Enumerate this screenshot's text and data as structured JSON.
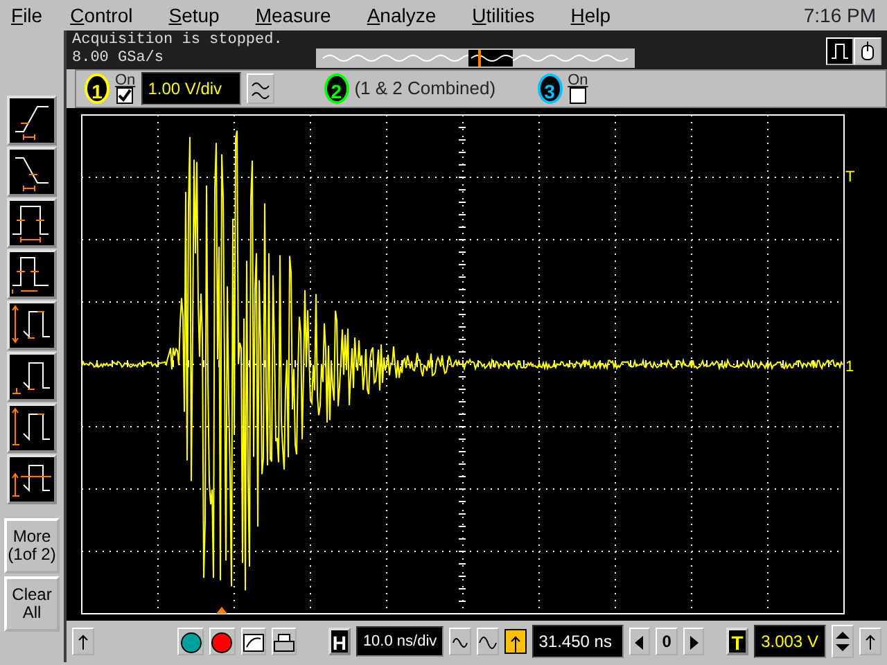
{
  "menu": [
    {
      "label": "File"
    },
    {
      "label": "Control"
    },
    {
      "label": "Setup"
    },
    {
      "label": "Measure"
    },
    {
      "label": "Analyze"
    },
    {
      "label": "Utilities"
    },
    {
      "label": "Help"
    }
  ],
  "clock": "7:16 PM",
  "status": {
    "message": "Acquisition is stopped.",
    "sample_rate": "8.00 GSa/s"
  },
  "channels": [
    {
      "kind": "scaled",
      "number": "1",
      "color": "#ffff00",
      "on_label": "On",
      "checked": true,
      "scale": "1.00 V/div"
    },
    {
      "kind": "combined",
      "number": "2",
      "color": "#00ff00",
      "label": "(1 & 2 Combined)"
    },
    {
      "kind": "toggle",
      "number": "3",
      "color": "#00c0ff",
      "on_label": "On",
      "checked": false
    }
  ],
  "tools": [
    {
      "kind": "rise"
    },
    {
      "kind": "fall"
    },
    {
      "kind": "width"
    },
    {
      "kind": "freq"
    },
    {
      "kind": "pp"
    },
    {
      "kind": "min"
    },
    {
      "kind": "max"
    },
    {
      "kind": "avg"
    }
  ],
  "side_buttons": [
    {
      "label": "More (1of 2)"
    },
    {
      "label": "Clear All"
    }
  ],
  "markers": {
    "trigger_label": "T",
    "channel_label": "1"
  },
  "bottom": {
    "horizontal_label": "H",
    "time_scale": "10.0 ns/div",
    "position": "31.450 ns",
    "center_label": "0",
    "trigger_label": "T",
    "trigger_level": "3.003 V"
  }
}
